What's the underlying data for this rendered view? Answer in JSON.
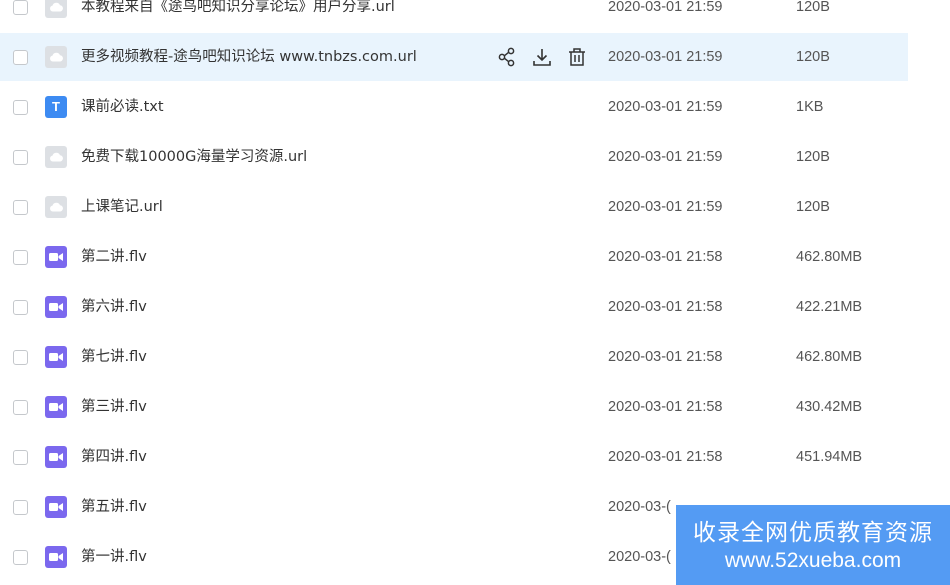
{
  "files": [
    {
      "name": "本教程来自《途鸟吧知识分享论坛》用户分享.url",
      "type": "url",
      "time": "2020-03-01 21:59",
      "size": "120B"
    },
    {
      "name": "更多视频教程-途鸟吧知识论坛 www.tnbzs.com.url",
      "type": "url",
      "time": "2020-03-01 21:59",
      "size": "120B",
      "hover": true
    },
    {
      "name": "课前必读.txt",
      "type": "txt",
      "time": "2020-03-01 21:59",
      "size": "1KB"
    },
    {
      "name": "免费下载10000G海量学习资源.url",
      "type": "url",
      "time": "2020-03-01 21:59",
      "size": "120B"
    },
    {
      "name": "上课笔记.url",
      "type": "url",
      "time": "2020-03-01 21:59",
      "size": "120B"
    },
    {
      "name": "第二讲.flv",
      "type": "video",
      "time": "2020-03-01 21:58",
      "size": "462.80MB"
    },
    {
      "name": "第六讲.flv",
      "type": "video",
      "time": "2020-03-01 21:58",
      "size": "422.21MB"
    },
    {
      "name": "第七讲.flv",
      "type": "video",
      "time": "2020-03-01 21:58",
      "size": "462.80MB"
    },
    {
      "name": "第三讲.flv",
      "type": "video",
      "time": "2020-03-01 21:58",
      "size": "430.42MB"
    },
    {
      "name": "第四讲.flv",
      "type": "video",
      "time": "2020-03-01 21:58",
      "size": "451.94MB"
    },
    {
      "name": "第五讲.flv",
      "type": "video",
      "time": "2020-03-(",
      "size": ""
    },
    {
      "name": "第一讲.flv",
      "type": "video",
      "time": "2020-03-(",
      "size": ""
    }
  ],
  "file_icon_labels": {
    "txt": "T"
  },
  "row_actions": [
    "share-icon",
    "download-icon",
    "delete-icon"
  ],
  "colors": {
    "hover": "#e9f4fd",
    "txt_icon": "#3d8bf2",
    "video_icon": "#7b68ee",
    "url_icon": "#dde0e4",
    "watermark": "#3d8ef2"
  },
  "watermark": {
    "line1": "收录全网优质教育资源",
    "line2": "www.52xueba.com"
  }
}
